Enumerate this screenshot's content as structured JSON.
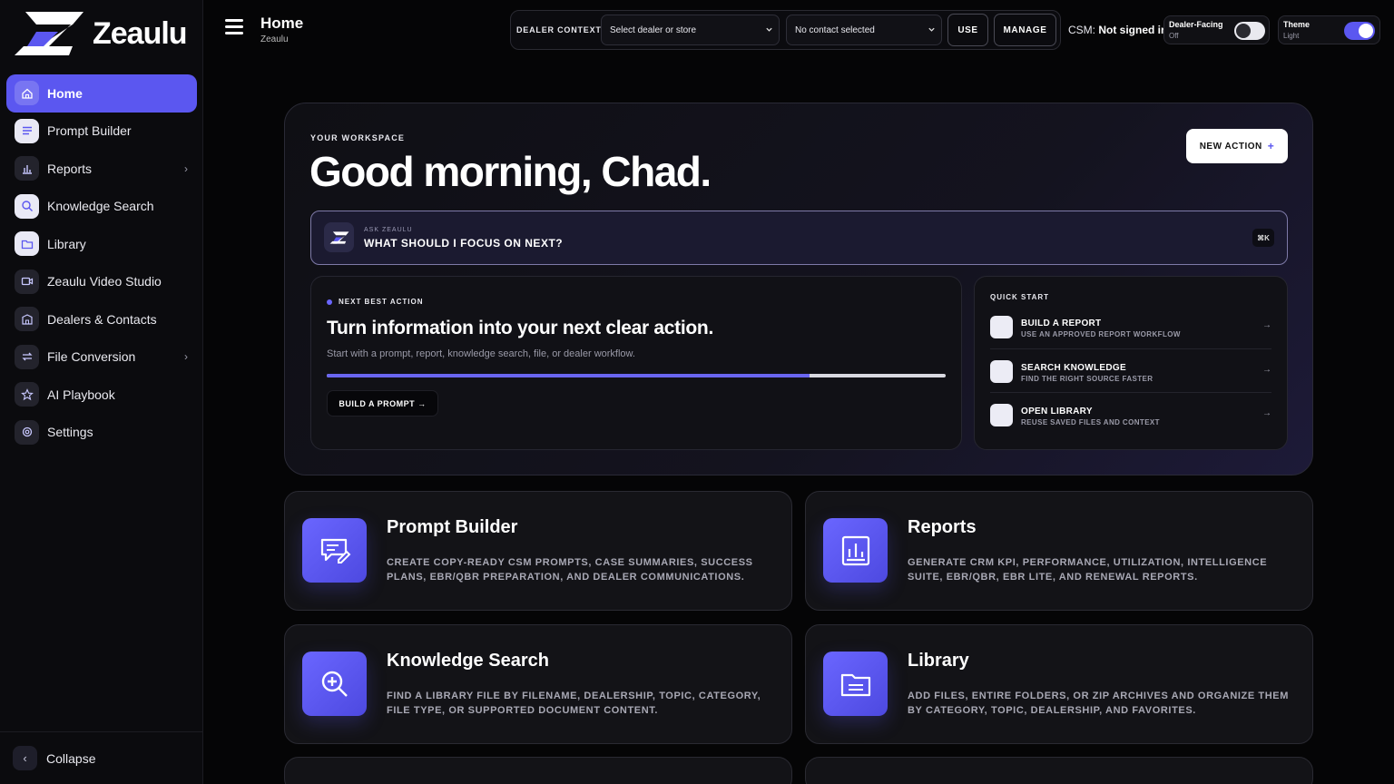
{
  "brand": {
    "name": "Zeaulu"
  },
  "header": {
    "title": "Home",
    "subtitle": "Zeaulu"
  },
  "sidebar": {
    "items": [
      {
        "label": "Home",
        "icon": "home-icon",
        "active": true
      },
      {
        "label": "Prompt Builder",
        "icon": "sliders-icon"
      },
      {
        "label": "Reports",
        "icon": "bar-chart-icon",
        "chevron": "›"
      },
      {
        "label": "Knowledge Search",
        "icon": "search-icon"
      },
      {
        "label": "Library",
        "icon": "folder-icon"
      },
      {
        "label": "Zeaulu Video Studio",
        "icon": "video-icon"
      },
      {
        "label": "Dealers & Contacts",
        "icon": "building-icon"
      },
      {
        "label": "File Conversion",
        "icon": "swap-icon",
        "chevron": "›"
      },
      {
        "label": "AI Playbook",
        "icon": "star-icon"
      },
      {
        "label": "Settings",
        "icon": "gear-icon"
      }
    ],
    "collapse_label": "Collapse"
  },
  "dealer_context": {
    "label": "DEALER CONTEXT",
    "dealer_select": "Select dealer or store",
    "contact_select": "No contact selected",
    "use_label": "USE",
    "manage_label": "MANAGE"
  },
  "csm": {
    "prefix": "CSM:",
    "status": "Not signed in"
  },
  "toggles": {
    "dealer_facing": {
      "title": "Dealer-Facing",
      "state": "Off"
    },
    "theme": {
      "title": "Theme",
      "state": "Light"
    }
  },
  "hero": {
    "kicker": "YOUR WORKSPACE",
    "greeting": "Good morning, Chad.",
    "new_action_label": "NEW ACTION",
    "new_action_icon": "+",
    "ask": {
      "kicker": "ASK ZEAULU",
      "text": "WHAT SHOULD I FOCUS ON NEXT?",
      "shortcut": "⌘K"
    }
  },
  "next_best_action": {
    "kicker": "NEXT BEST ACTION",
    "title": "Turn information into your next clear action.",
    "subtitle": "Start with a prompt, report, knowledge search, file, or dealer workflow.",
    "progress": 0.78,
    "button_label": "BUILD A PROMPT →"
  },
  "quick_start": {
    "kicker": "QUICK START",
    "items": [
      {
        "title": "BUILD A REPORT",
        "subtitle": "USE AN APPROVED REPORT WORKFLOW",
        "arrow": "→"
      },
      {
        "title": "SEARCH KNOWLEDGE",
        "subtitle": "FIND THE RIGHT SOURCE FASTER",
        "arrow": "→"
      },
      {
        "title": "OPEN LIBRARY",
        "subtitle": "REUSE SAVED FILES AND CONTEXT",
        "arrow": "→"
      }
    ]
  },
  "cards": [
    {
      "title": "Prompt Builder",
      "desc": "CREATE COPY-READY CSM PROMPTS, CASE SUMMARIES, SUCCESS PLANS, EBR/QBR PREPARATION, AND DEALER COMMUNICATIONS.",
      "icon": "chat-pencil-icon"
    },
    {
      "title": "Reports",
      "desc": "GENERATE CRM KPI, PERFORMANCE, UTILIZATION, INTELLIGENCE SUITE, EBR/QBR, EBR LITE, AND RENEWAL REPORTS.",
      "icon": "bar-chart-icon"
    },
    {
      "title": "Knowledge Search",
      "desc": "FIND A LIBRARY FILE BY FILENAME, DEALERSHIP, TOPIC, CATEGORY, FILE TYPE, OR SUPPORTED DOCUMENT CONTENT.",
      "icon": "zoom-in-icon"
    },
    {
      "title": "Library",
      "desc": "ADD FILES, ENTIRE FOLDERS, OR ZIP ARCHIVES AND ORGANIZE THEM BY CATEGORY, TOPIC, DEALERSHIP, AND FAVORITES.",
      "icon": "folder-icon"
    }
  ],
  "colors": {
    "accent": "#5b57f0",
    "background": "#050506",
    "card": "#131317"
  }
}
